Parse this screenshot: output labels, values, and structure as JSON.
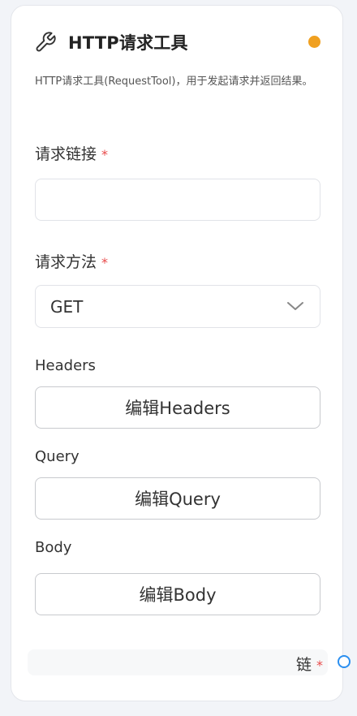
{
  "node": {
    "title": "HTTP请求工具",
    "icon": "wrench-icon",
    "status_color": "#f0a020",
    "description": "HTTP请求工具(RequestTool)，用于发起请求并返回结果。"
  },
  "fields": {
    "url": {
      "label": "请求链接",
      "required_mark": "*",
      "value": "",
      "placeholder": ""
    },
    "method": {
      "label": "请求方法",
      "required_mark": "*",
      "value": "GET"
    },
    "headers": {
      "label": "Headers",
      "button": "编辑Headers"
    },
    "query": {
      "label": "Query",
      "button": "编辑Query"
    },
    "body": {
      "label": "Body",
      "button": "编辑Body"
    }
  },
  "output": {
    "label": "链",
    "required_mark": "*",
    "handle_color": "#2b8ff0"
  }
}
